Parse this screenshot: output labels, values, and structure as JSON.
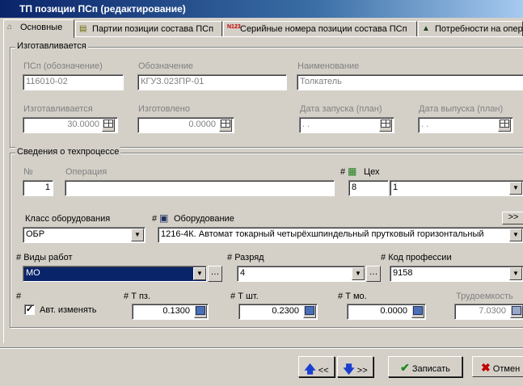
{
  "window": {
    "title": "ТП позиции ПСп (редактирование)"
  },
  "tabs": [
    {
      "label": "Основные",
      "icon": "home-icon"
    },
    {
      "label": "Партии позиции состава ПСп",
      "icon": "document-icon"
    },
    {
      "label": "Серийные номера позиции состава ПСп",
      "icon": "serial-number-icon"
    },
    {
      "label": "Потребности на опер",
      "icon": "warning-icon"
    }
  ],
  "manufactured": {
    "title": "Изготавливается",
    "psp_label": "ПСп (обозначение)",
    "psp_value": "116010-02",
    "designation_label": "Обозначение",
    "designation_value": "КГУЗ.023ПР-01",
    "name_label": "Наименование",
    "name_value": "Толкатель",
    "qty_label": "Изготавливается",
    "qty_value": "30.0000",
    "made_label": "Изготовлено",
    "made_value": "0.0000",
    "start_label": "Дата запуска (план)",
    "start_value": ". .",
    "release_label": "Дата выпуска (план)",
    "release_value": ". ."
  },
  "process": {
    "title": "Сведения о техпроцессе",
    "num_label": "№",
    "num_value": "1",
    "operation_label": "Операция",
    "operation_value": "",
    "hash": "#",
    "workshop_label": "Цех",
    "workshop_code": "8",
    "workshop_value": "1",
    "equip_class_label": "Класс оборудования",
    "equip_class_value": "ОБР",
    "equipment_label": "Оборудование",
    "equipment_value": "1216-4К. Автомат токарный четырёхшпиндельный прутковый горизонтальный",
    "more_button": ">>",
    "work_type_label": "Виды работ",
    "work_type_value": "МО",
    "grade_label": "Разряд",
    "grade_value": "4",
    "profession_label": "Код профессии",
    "profession_value": "9158",
    "auto_change_label": "Авт. изменять",
    "auto_change_checked": true,
    "t_pz_label": "Т пз.",
    "t_pz_value": "0.1300",
    "t_sht_label": "Т шт.",
    "t_sht_value": "0.2300",
    "t_mo_label": "Т мо.",
    "t_mo_value": "0.0000",
    "labor_label": "Трудоемкость",
    "labor_value": "7.0300"
  },
  "footer": {
    "prev_label": "<<",
    "next_label": ">>",
    "save_label": "Записать",
    "cancel_label": "Отмен"
  }
}
